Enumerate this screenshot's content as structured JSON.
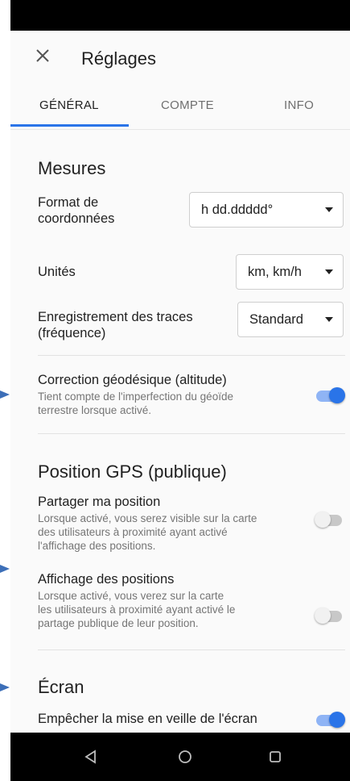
{
  "appbar": {
    "title": "Réglages",
    "close_icon": "close-icon"
  },
  "tabs": [
    {
      "label": "GÉNÉRAL",
      "active": true
    },
    {
      "label": "COMPTE",
      "active": false
    },
    {
      "label": "INFO",
      "active": false
    }
  ],
  "mesures": {
    "heading": "Mesures",
    "coord_format": {
      "label_line1": "Format de",
      "label_line2": "coordonnées",
      "value": "h dd.ddddd°"
    },
    "units": {
      "label": "Unités",
      "value": "km, km/h"
    },
    "tracks": {
      "label_line1": "Enregistrement des traces",
      "label_line2": "(fréquence)",
      "value": "Standard"
    },
    "geodesic": {
      "label": "Correction géodésique (altitude)",
      "desc_line1": "Tient compte de l'imperfection du géoïde",
      "desc_line2": "terrestre lorsque activé.",
      "enabled": true
    }
  },
  "gps": {
    "heading": "Position GPS (publique)",
    "share": {
      "label": "Partager ma position",
      "desc_line1": "Lorsque activé, vous serez visible sur la carte",
      "desc_line2": "des utilisateurs à proximité ayant activé",
      "desc_line3": "l'affichage des positions.",
      "enabled": false
    },
    "display": {
      "label": "Affichage des positions",
      "desc_line1": "Lorsque activé, vous verez sur la carte",
      "desc_line2": "les utilisateurs à proximité ayant activé le",
      "desc_line3": "partage publique de leur position.",
      "enabled": false
    }
  },
  "screen": {
    "heading": "Écran",
    "keep_awake": {
      "label": "Empêcher la mise en veille de l'écran",
      "enabled": true
    }
  },
  "colors": {
    "accent": "#2a74e8",
    "toggle_track_on": "#8fb4f5",
    "annotation_arrow": "#3d6fb8"
  },
  "navbar": {
    "icons": [
      "back-triangle-icon",
      "home-circle-icon",
      "recents-square-icon"
    ]
  }
}
